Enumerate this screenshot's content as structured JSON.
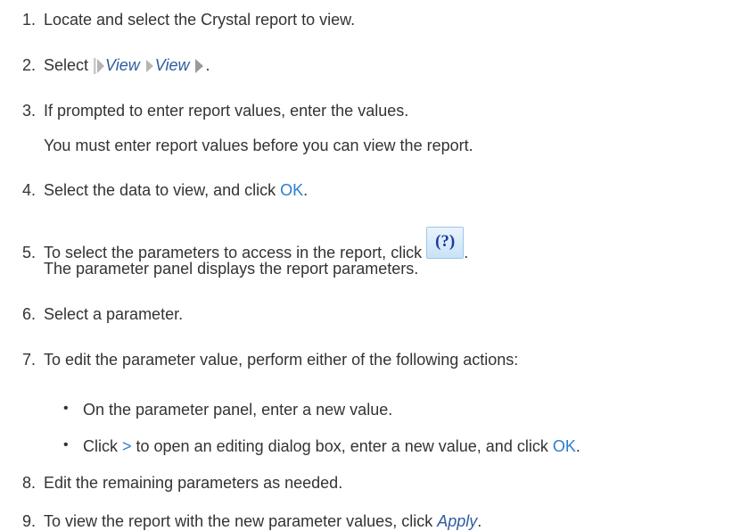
{
  "steps": [
    {
      "n": "1.",
      "text": "Locate and select the Crystal report to view."
    },
    {
      "n": "2.",
      "pre": "Select",
      "menu1": "View",
      "menu2": "View",
      "post": "."
    },
    {
      "n": "3.",
      "text": "If prompted to enter report values, enter the values.",
      "sub": "You must enter report values before you can view the report."
    },
    {
      "n": "4.",
      "pre": "Select the data to view, and click ",
      "ok": "OK",
      "post": "."
    },
    {
      "n": "5.",
      "pre": "To select the parameters to access in the report, click ",
      "icon_glyph": "(?)",
      "post": ".",
      "sub": "The parameter panel displays the report parameters."
    },
    {
      "n": "6.",
      "text": "Select a parameter."
    },
    {
      "n": "7.",
      "text": "To edit the parameter value, perform either of the following actions:"
    },
    {
      "n": "8.",
      "text": "Edit the remaining parameters as needed."
    },
    {
      "n": "9.",
      "pre": "To view the report with the new parameter values, click ",
      "apply": "Apply",
      "post": "."
    }
  ],
  "bullets": [
    {
      "text": "On the parameter panel, enter a new value."
    },
    {
      "pre": "Click ",
      "gt": ">",
      "mid": " to open an editing dialog box, enter a new value, and click ",
      "ok": "OK",
      "post": "."
    }
  ],
  "colors": {
    "text": "#333333",
    "ui_term": "#2e5d9c",
    "link": "#2e7ccc",
    "icon_bg": "#d7eaf9",
    "icon_glyph": "#1a3aa0"
  },
  "icons": [
    "menu-path-arrow-icon",
    "parameter-panel-icon"
  ]
}
